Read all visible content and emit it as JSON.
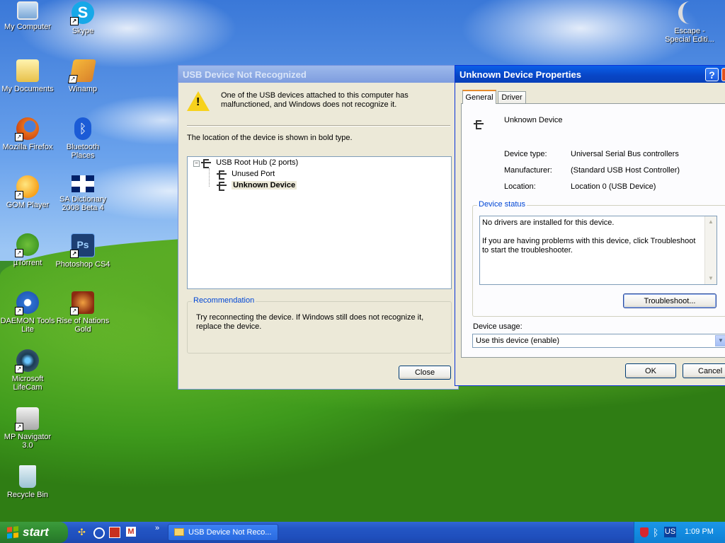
{
  "desktop": {
    "icons": [
      {
        "label": "My Computer",
        "name": "my-computer-icon",
        "shortcut": false
      },
      {
        "label": "Skype",
        "name": "skype-icon",
        "shortcut": true
      },
      {
        "label": "My Documents",
        "name": "my-documents-icon",
        "shortcut": false
      },
      {
        "label": "Winamp",
        "name": "winamp-icon",
        "shortcut": true
      },
      {
        "label": "Mozilla Firefox",
        "name": "firefox-icon",
        "shortcut": true
      },
      {
        "label": "Bluetooth Places",
        "name": "bluetooth-icon",
        "shortcut": false
      },
      {
        "label": "GOM Player",
        "name": "gom-player-icon",
        "shortcut": true
      },
      {
        "label": "SA Dictionary 2008 Beta 4",
        "name": "uk-flag-icon",
        "shortcut": false
      },
      {
        "label": "µTorrent",
        "name": "utorrent-icon",
        "shortcut": true
      },
      {
        "label": "Photoshop CS4",
        "name": "photoshop-icon",
        "shortcut": true
      },
      {
        "label": "DAEMON Tools Lite",
        "name": "daemon-tools-icon",
        "shortcut": true
      },
      {
        "label": "Rise of Nations Gold",
        "name": "rise-of-nations-icon",
        "shortcut": true
      },
      {
        "label": "Microsoft LifeCam",
        "name": "lifecam-icon",
        "shortcut": true
      },
      {
        "label": "MP Navigator 3.0",
        "name": "mp-navigator-icon",
        "shortcut": true
      },
      {
        "label": "Recycle Bin",
        "name": "recycle-bin-icon",
        "shortcut": false
      },
      {
        "label": "Escape - Special Editi...",
        "name": "escape-game-icon",
        "shortcut": false
      }
    ]
  },
  "usb_dialog": {
    "title": "USB Device Not Recognized",
    "message": "One of the USB devices attached to this computer has malfunctioned, and Windows does not recognize it.",
    "location_note": "The location of the device is shown in bold type.",
    "tree": {
      "root": "USB Root Hub (2 ports)",
      "children": [
        "Unused Port",
        "Unknown Device"
      ]
    },
    "recommendation_label": "Recommendation",
    "recommendation_text": "Try reconnecting the device. If Windows still does not recognize it, replace the device.",
    "close_label": "Close"
  },
  "properties_dialog": {
    "title": "Unknown Device Properties",
    "help_label": "?",
    "tabs": [
      {
        "label": "General"
      },
      {
        "label": "Driver"
      }
    ],
    "device_name": "Unknown Device",
    "fields": [
      {
        "label": "Device type:",
        "value": "Universal Serial Bus controllers"
      },
      {
        "label": "Manufacturer:",
        "value": "(Standard USB Host Controller)"
      },
      {
        "label": "Location:",
        "value": "Location 0 (USB Device)"
      }
    ],
    "status_label": "Device status",
    "status_line1": "No drivers are installed for this device.",
    "status_line2": "If you are having problems with this device, click Troubleshoot to start the troubleshooter.",
    "troubleshoot_label": "Troubleshoot...",
    "usage_label": "Device usage:",
    "usage_value": "Use this device (enable)",
    "ok_label": "OK",
    "cancel_label": "Cancel"
  },
  "taskbar": {
    "start_label": "start",
    "task_label": "USB Device Not Reco...",
    "chevron": "»",
    "language": "US",
    "clock": "1:09 PM"
  }
}
